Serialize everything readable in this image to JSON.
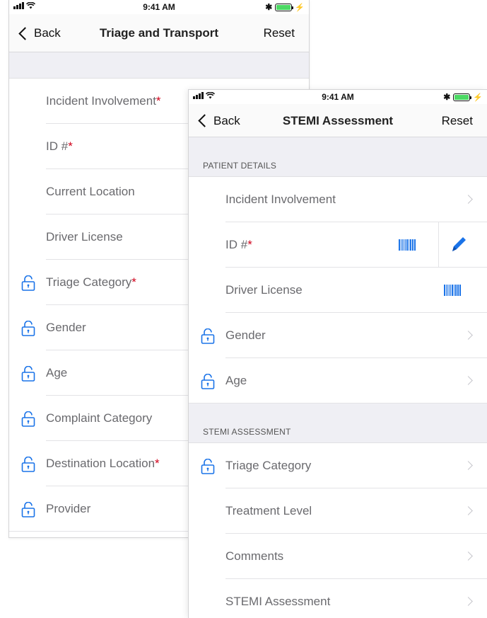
{
  "status": {
    "time": "9:41 AM",
    "bluetooth": "✱",
    "bolt": "⚡"
  },
  "back_screen": {
    "nav": {
      "back": "Back",
      "title": "Triage and Transport",
      "reset": "Reset"
    },
    "rows": [
      {
        "label": "Incident Involvement",
        "required": true,
        "locked": false
      },
      {
        "label": "ID #",
        "required": true,
        "locked": false
      },
      {
        "label": "Current Location",
        "required": false,
        "locked": false
      },
      {
        "label": "Driver License",
        "required": false,
        "locked": false
      },
      {
        "label": "Triage Category",
        "required": true,
        "locked": true
      },
      {
        "label": "Gender",
        "required": false,
        "locked": true
      },
      {
        "label": "Age",
        "required": false,
        "locked": true
      },
      {
        "label": "Complaint Category",
        "required": false,
        "locked": true
      },
      {
        "label": "Destination Location",
        "required": true,
        "locked": true
      },
      {
        "label": "Provider",
        "required": false,
        "locked": true
      }
    ]
  },
  "front_screen": {
    "nav": {
      "back": "Back",
      "title": "STEMI Assessment",
      "reset": "Reset"
    },
    "section_patient": {
      "header": "PATIENT DETAILS",
      "rows": [
        {
          "label": "Incident Involvement",
          "required": false,
          "locked": false
        },
        {
          "label": "ID #",
          "required": true,
          "locked": false
        },
        {
          "label": "Driver License",
          "required": false,
          "locked": false
        },
        {
          "label": "Gender",
          "required": false,
          "locked": true
        },
        {
          "label": "Age",
          "required": false,
          "locked": true
        }
      ]
    },
    "section_stemi": {
      "header": "STEMI ASSESSMENT",
      "rows": [
        {
          "label": "Triage Category",
          "required": false,
          "locked": true
        },
        {
          "label": "Treatment Level",
          "required": false,
          "locked": false
        },
        {
          "label": "Comments",
          "required": false,
          "locked": false
        },
        {
          "label": "STEMI Assessment",
          "required": false,
          "locked": false
        }
      ]
    }
  },
  "colors": {
    "accent": "#1a73e8",
    "required": "#d0021b",
    "battery": "#4cd964"
  },
  "icons": [
    "lock-open-icon",
    "chevron-right-icon",
    "barcode-icon",
    "pencil-icon",
    "back-chevron-icon"
  ]
}
